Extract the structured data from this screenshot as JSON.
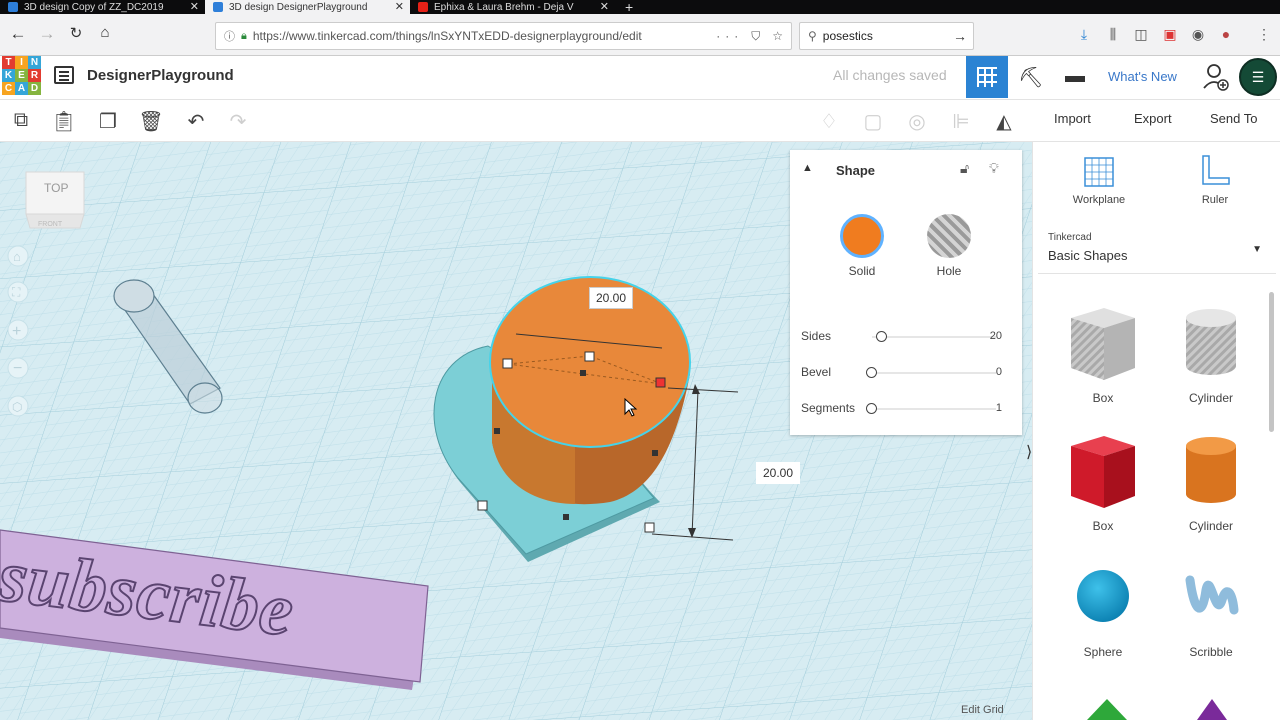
{
  "browser": {
    "tabs": [
      {
        "label": "3D design Copy of ZZ_DC2019",
        "active": false,
        "favicon_color": "#2e7fd9"
      },
      {
        "label": "3D design DesignerPlayground",
        "active": true,
        "favicon_color": "#2e7fd9"
      },
      {
        "label": "Ephixa & Laura Brehm - Deja V",
        "active": false,
        "favicon_color": "#e62117"
      }
    ],
    "url": "https://www.tinkercad.com/things/lnSxYNTxEDD-designerplayground/edit",
    "search_value": "posestics"
  },
  "header": {
    "title": "DesignerPlayground",
    "save_status": "All changes saved",
    "whats_new": "What's New",
    "logo_letters": [
      "T",
      "I",
      "N",
      "K",
      "E",
      "R",
      "C",
      "A",
      "D"
    ]
  },
  "toolbar": {
    "import": "Import",
    "export": "Export",
    "send_to": "Send To"
  },
  "workspace": {
    "viewcube_label": "TOP",
    "viewcube_sub": "FRONT",
    "dim_width": "20.00",
    "dim_height": "20.00",
    "subscribe_text": "subscribe",
    "edit_grid": "Edit Grid"
  },
  "inspector": {
    "title": "Shape",
    "solid_label": "Solid",
    "hole_label": "Hole",
    "params": [
      {
        "name": "Sides",
        "value": "20",
        "level": 0
      },
      {
        "name": "Bevel",
        "value": "0",
        "level": 0
      },
      {
        "name": "Segments",
        "value": "1",
        "level": 0
      }
    ],
    "solid_color": "#f07c1f"
  },
  "right_panel": {
    "workplane": "Workplane",
    "ruler": "Ruler",
    "category_source": "Tinkercad",
    "category": "Basic Shapes",
    "shapes": [
      {
        "label": "Box",
        "icon": "box-hole-icon"
      },
      {
        "label": "Cylinder",
        "icon": "cylinder-hole-icon"
      },
      {
        "label": "Box",
        "icon": "box-icon"
      },
      {
        "label": "Cylinder",
        "icon": "cylinder-icon"
      },
      {
        "label": "Sphere",
        "icon": "sphere-icon"
      },
      {
        "label": "Scribble",
        "icon": "scribble-icon"
      }
    ]
  },
  "colors": {
    "accent": "#2b83d3",
    "workplane": "#d7ecf2",
    "heart": "#7ccfd6",
    "cylinder": "#e8883a",
    "subscribe": "#cdb1de"
  }
}
